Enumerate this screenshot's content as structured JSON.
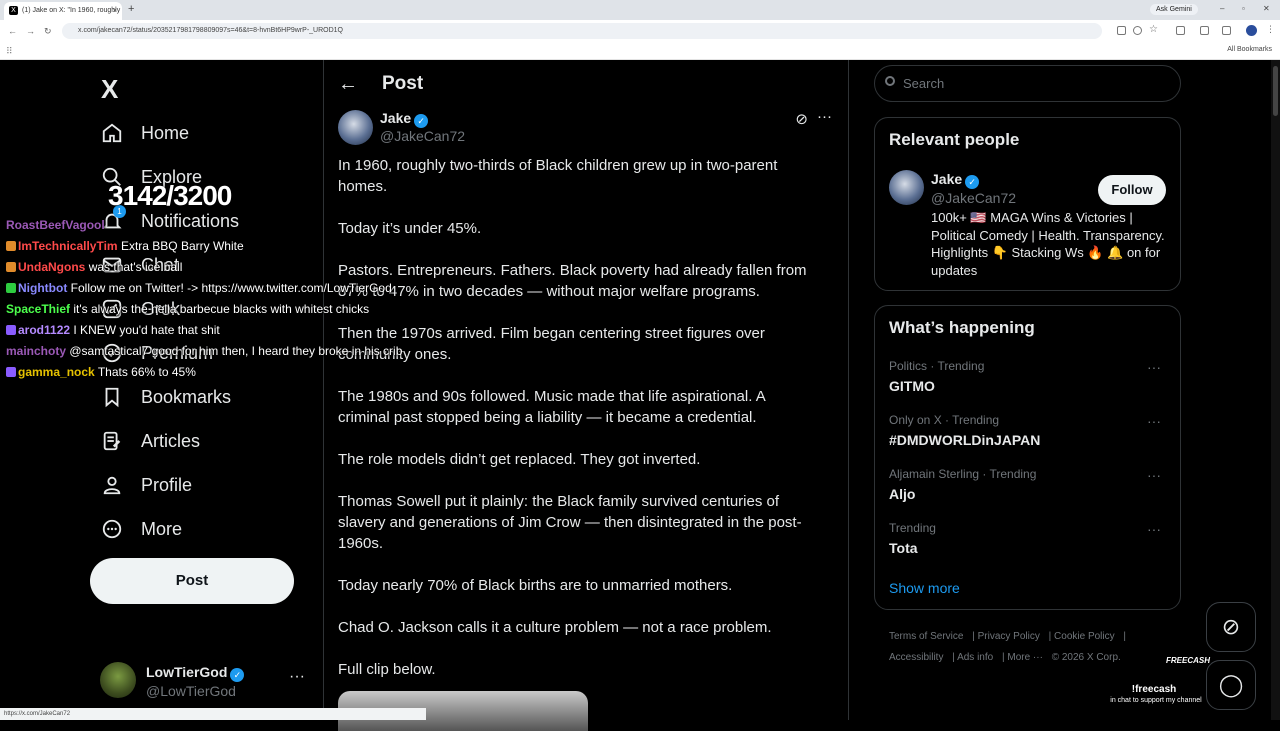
{
  "browser": {
    "tab_title": "(1) Jake on X: \"In 1960, roughly",
    "tab_close": "×",
    "new_tab": "+",
    "ask_gemini": "Ask Gemini",
    "url": "x.com/jakecan72/status/2035217981798809097s=46&t=8-hvnBt6HP9wrP-_UROD1Q",
    "all_bookmarks": "All Bookmarks",
    "status_url": "https://x.com/JakeCan72"
  },
  "sidebar": {
    "logo": "X",
    "items": [
      {
        "label": "Home",
        "icon": "home-icon"
      },
      {
        "label": "Explore",
        "icon": "search-icon"
      },
      {
        "label": "Notifications",
        "icon": "bell-icon",
        "badge": "1"
      },
      {
        "label": "Chat",
        "icon": "mail-icon"
      },
      {
        "label": "Grok",
        "icon": "grok-icon"
      },
      {
        "label": "Premium",
        "icon": "x-premium-icon"
      },
      {
        "label": "Bookmarks",
        "icon": "bookmark-icon"
      },
      {
        "label": "Articles",
        "icon": "article-icon"
      },
      {
        "label": "Profile",
        "icon": "person-icon"
      },
      {
        "label": "More",
        "icon": "more-circle-icon"
      }
    ],
    "post_button": "Post",
    "account": {
      "name": "LowTierGod",
      "handle": "@LowTierGod",
      "more": "···"
    }
  },
  "overlay": {
    "counter": "3142/3200",
    "chat": [
      {
        "user": "RoastBeefVagool",
        "color": "#9b59b6",
        "text": ""
      },
      {
        "user": "ImTechnicallyTim",
        "color": "#ff4a4a",
        "text": "Extra BBQ Barry White"
      },
      {
        "user": "UndaNgons",
        "color": "#ff4a4a",
        "text": "was that's ice ball"
      },
      {
        "user": "Nightbot",
        "color": "#8a8aff",
        "text": "Follow me on Twitter! -> https://www.twitter.com/LowTierGod"
      },
      {
        "user": "SpaceThief",
        "color": "#4cff4c",
        "text": "it's always the hella barbecue blacks with whitest chicks"
      },
      {
        "user": "arod1122",
        "color": "#b48aff",
        "text": "I KNEW you'd hate that shit"
      },
      {
        "user": "mainchoty",
        "color": "#9b59b6",
        "text": "@samtastical7 good for him then, I heard they broke in his crib"
      },
      {
        "user": "gamma_nock",
        "color": "#e6c200",
        "text": "Thats 66% to 45%"
      }
    ]
  },
  "post": {
    "header_title": "Post",
    "author_name": "Jake",
    "author_handle": "@JakeCan72",
    "paragraphs": [
      "In 1960, roughly two-thirds of Black children grew up in two-parent homes.",
      "Today it’s under 45%.",
      "Pastors. Entrepreneurs. Fathers. Black poverty had already fallen from 87% to 47% in two decades — without major welfare programs.",
      "Then the 1970s arrived. Film began centering street figures over community ones.",
      "The 1980s and 90s followed. Music made that life aspirational. A criminal past stopped being a liability — it became a credential.",
      "The role models didn’t get replaced. They got inverted.",
      "Thomas Sowell put it plainly: the Black family survived centuries of slavery and generations of Jim Crow — then disintegrated in the post-1960s.",
      "Today nearly 70% of Black births are to unmarried mothers.",
      "Chad O. Jackson calls it a culture problem — not a race problem.",
      "Full clip below."
    ]
  },
  "right": {
    "search_placeholder": "Search",
    "relevant_title": "Relevant people",
    "person": {
      "name": "Jake",
      "handle": "@JakeCan72",
      "follow": "Follow",
      "bio": "100k+ 🇺🇸 MAGA Wins & Victories | Political Comedy | Health. Transparency. Highlights 👇 Stacking Ws 🔥 🔔 on for updates"
    },
    "happening_title": "What’s happening",
    "trends": [
      {
        "context": "Politics · Trending",
        "title": "GITMO"
      },
      {
        "context": "Only on X · Trending",
        "title": "#DMDWORLDinJAPAN"
      },
      {
        "context": "Aljamain Sterling · Trending",
        "title": "Aljo"
      },
      {
        "context": "Trending",
        "title": "Tota"
      }
    ],
    "show_more": "Show more",
    "footer": [
      "Terms of Service",
      "Privacy Policy",
      "Cookie Policy",
      "Accessibility",
      "Ads info",
      "More ···",
      "© 2026 X Corp."
    ]
  },
  "promo": {
    "brand": "FREECASH",
    "command": "!freecash",
    "tagline": "in chat to support my channel"
  }
}
